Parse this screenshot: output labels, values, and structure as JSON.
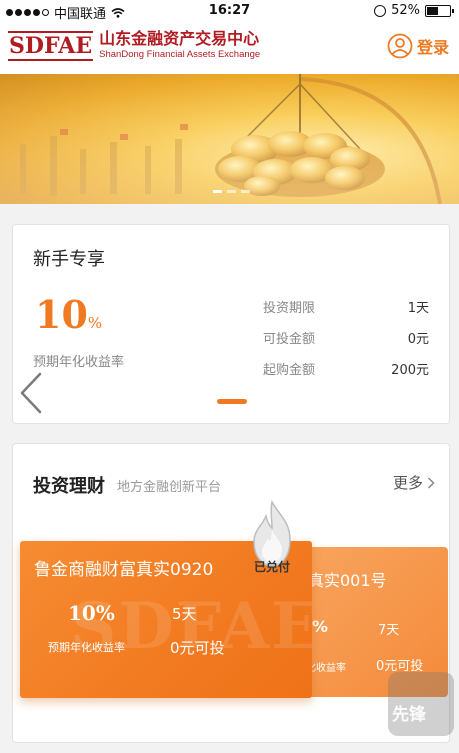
{
  "status_bar": {
    "carrier": "中国联通",
    "time": "16:27",
    "battery": "52%",
    "battery_level": 0.52
  },
  "header": {
    "logo_mark": "SDFAE",
    "logo_cn": "山东金融资产交易中心",
    "logo_en": "ShanDong Financial Assets Exchange",
    "login_label": "登录",
    "accent_color": "#f07a22",
    "brand_color": "#b01c22"
  },
  "banner": {
    "slide_count": 3,
    "active_slide": 1
  },
  "newbie": {
    "title": "新手专享",
    "rate_value": "10",
    "rate_unit": "%",
    "rate_label": "预期年化收益率",
    "info": [
      {
        "label": "投资期限",
        "value": "1天"
      },
      {
        "label": "可投金额",
        "value": "0元"
      },
      {
        "label": "起购金额",
        "value": "200元"
      }
    ]
  },
  "invest": {
    "title": "投资理财",
    "subtitle": "地方金融创新平台",
    "more_label": "更多",
    "products": [
      {
        "name": "鲁金商融财富真实0920",
        "rate": "10%",
        "rate_label": "预期年化收益率",
        "term": "5天",
        "available": "0元可投",
        "status": "已兑付"
      },
      {
        "name_partial": "真实001号",
        "rate_partial": "%",
        "rate_label_partial": "化收益率",
        "term": "7天",
        "available": "0元可投"
      }
    ]
  },
  "watermark": {
    "text": "先锋"
  }
}
